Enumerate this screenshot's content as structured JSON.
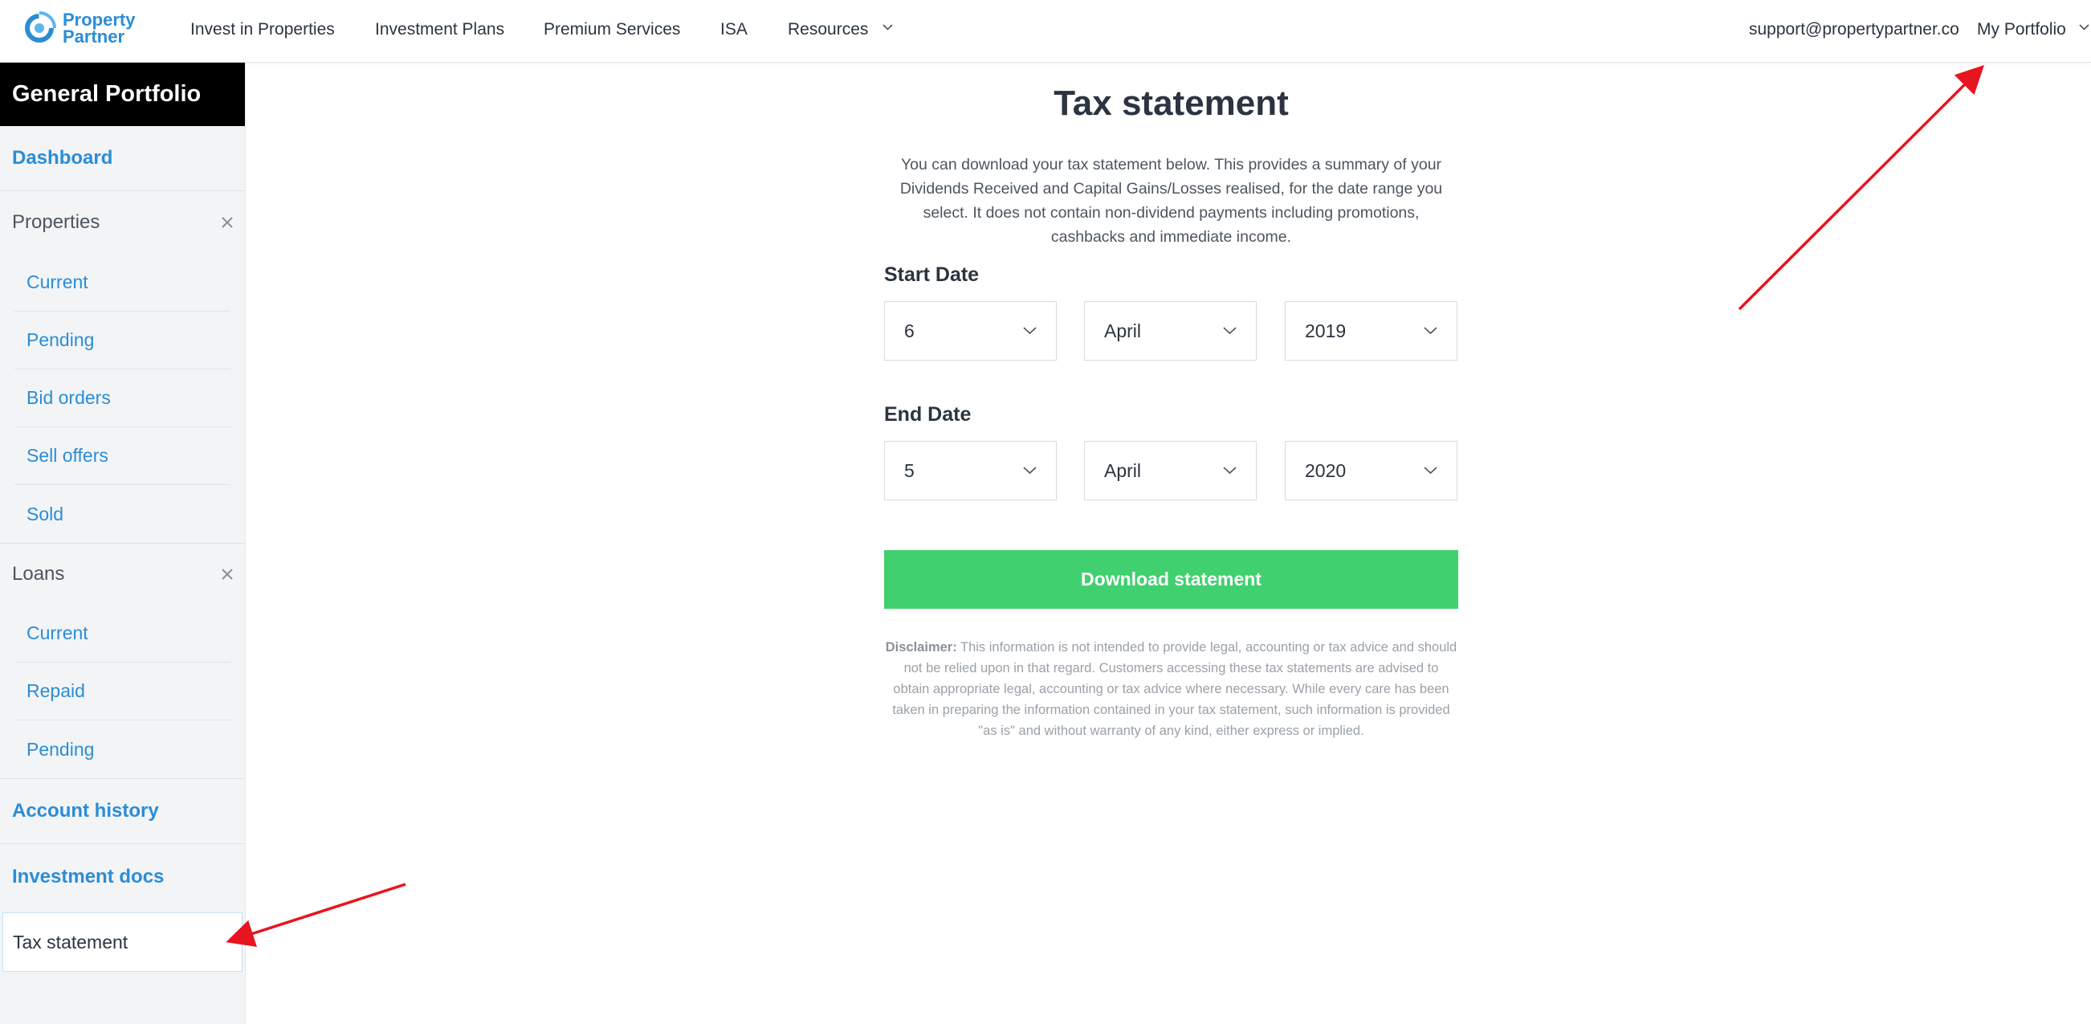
{
  "brand": {
    "line1": "Property",
    "line2": "Partner",
    "icon": "property-partner-logo-icon"
  },
  "nav": {
    "items": [
      "Invest in Properties",
      "Investment Plans",
      "Premium Services",
      "ISA",
      "Resources"
    ],
    "resources_icon": "chevron-down-icon",
    "support_email": "support@propertypartner.co",
    "portfolio_label": "My Portfolio",
    "portfolio_icon": "chevron-down-icon"
  },
  "sidebar": {
    "title": "General Portfolio",
    "dashboard": "Dashboard",
    "properties": {
      "label": "Properties",
      "close_icon": "close-icon",
      "items": [
        "Current",
        "Pending",
        "Bid orders",
        "Sell offers",
        "Sold"
      ]
    },
    "loans": {
      "label": "Loans",
      "close_icon": "close-icon",
      "items": [
        "Current",
        "Repaid",
        "Pending"
      ]
    },
    "account_history": "Account history",
    "investment_docs": "Investment docs",
    "tax_statement": "Tax statement"
  },
  "main": {
    "title": "Tax statement",
    "intro_lines": [
      "You can download your tax statement below. This provides a summary of your",
      "Dividends Received and Capital Gains/Losses realised, for the date range you",
      "select. It does not contain non-dividend payments including promotions,",
      "cashbacks and immediate income."
    ],
    "start_date": {
      "label": "Start Date",
      "day": "6",
      "month": "April",
      "year": "2019"
    },
    "end_date": {
      "label": "End Date",
      "day": "5",
      "month": "April",
      "year": "2020"
    },
    "download_label": "Download statement",
    "disclaimer_label": "Disclaimer:",
    "disclaimer_text": "This information is not intended to provide legal, accounting or tax advice and should not be relied upon in that regard. Customers accessing these tax statements are advised to obtain appropriate legal, accounting or tax advice where necessary. While every care has been taken in preparing the information contained in your tax statement, such information is provided \"as is\" and without warranty of any kind, either express or implied."
  },
  "colors": {
    "brand_blue": "#2a8dd6",
    "button_green": "#41d06f",
    "sidebar_bg": "#f3f4f6",
    "sidebar_header_bg": "#000000",
    "annotation_red": "#e8141f"
  }
}
